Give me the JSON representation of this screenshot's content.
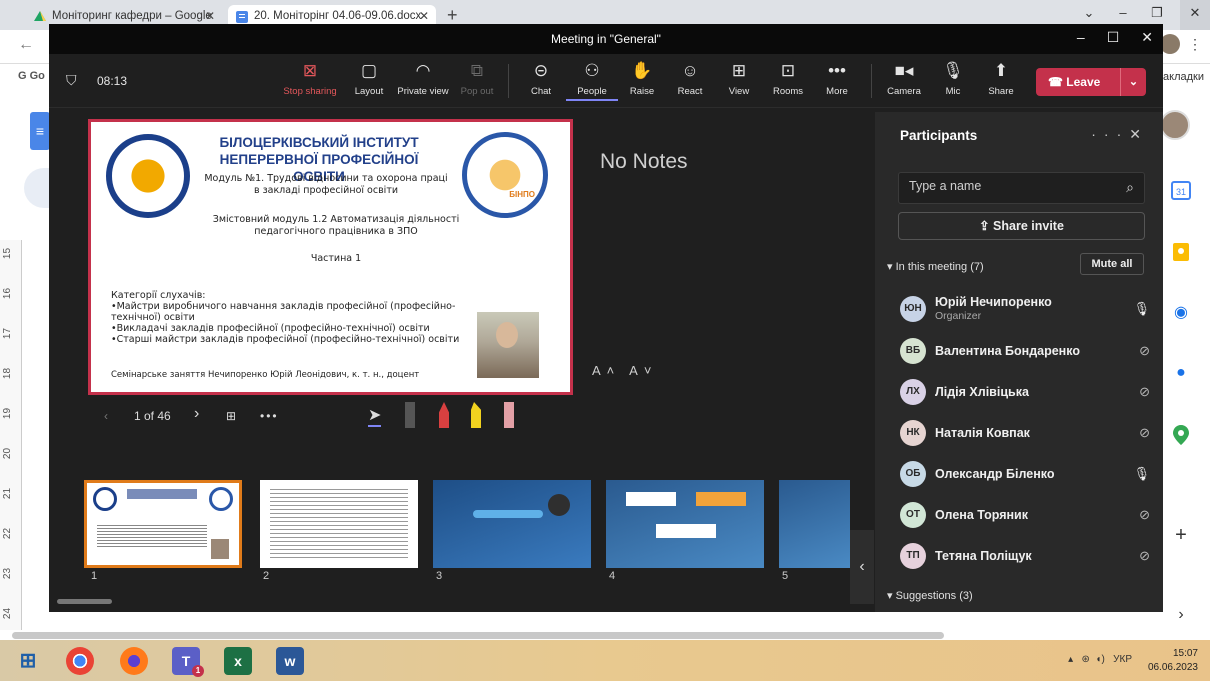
{
  "browser": {
    "tabs": [
      {
        "title": "Моніторинг кафедри – Google",
        "active": false
      },
      {
        "title": "20. Моніторінг 04.06-09.06.docx",
        "active": true
      }
    ],
    "bookmarks_label": "закладки",
    "bookmark_short": "G Go"
  },
  "teams": {
    "window_title": "Meeting in \"General\"",
    "timer": "08:13",
    "toolbar": [
      {
        "label": "Stop sharing",
        "icon": "stop-sharing-icon"
      },
      {
        "label": "Layout",
        "icon": "layout-icon"
      },
      {
        "label": "Private view",
        "icon": "eye-icon"
      },
      {
        "label": "Pop out",
        "icon": "pop-out-icon"
      },
      {
        "label": "Chat",
        "icon": "chat-icon"
      },
      {
        "label": "People",
        "icon": "people-icon"
      },
      {
        "label": "Raise",
        "icon": "raise-hand-icon"
      },
      {
        "label": "React",
        "icon": "react-icon"
      },
      {
        "label": "View",
        "icon": "view-icon"
      },
      {
        "label": "Rooms",
        "icon": "rooms-icon"
      },
      {
        "label": "More",
        "icon": "more-icon"
      },
      {
        "label": "Camera",
        "icon": "camera-icon"
      },
      {
        "label": "Mic",
        "icon": "mic-icon"
      },
      {
        "label": "Share",
        "icon": "share-icon"
      }
    ],
    "leave_label": "Leave",
    "notes_text": "No Notes",
    "font_size_label": "A˄ A˅",
    "slide_counter": "1 of 46",
    "thumbnail_numbers": [
      "1",
      "2",
      "3",
      "4",
      "5"
    ]
  },
  "slide": {
    "institute": "БІЛОЦЕРКІВСЬКИЙ ІНСТИТУТ НЕПЕРЕРВНОЇ ПРОФЕСІЙНОЇ ОСВІТИ",
    "module": "Модуль №1. Трудові відносини та охорона праці в закладі професійної освіти",
    "submodule": "Змістовний модуль 1.2 Автоматизація діяльності педагогічного працівника в ЗПО",
    "part": "Частина 1",
    "listeners_title": "Категорії слухачів:",
    "listeners": [
      "•Майстри виробничого навчання закладів професійної (професійно-технічної) освіти",
      "•Викладачі закладів професійної (професійно-технічної) освіти",
      "•Старші майстри закладів професійної (професійно-технічної) освіти"
    ],
    "seminar": "Семінарське заняття     Нечипоренко Юрій Леонідович, к. т. н., доцент",
    "logo_right_text": "БІНПО"
  },
  "participants": {
    "title": "Participants",
    "search_placeholder": "Type a name",
    "share_invite": "Share invite",
    "in_meeting": "In this meeting (7)",
    "mute_all": "Mute all",
    "suggestions": "Suggestions (3)",
    "people": [
      {
        "initials": "ЮН",
        "name": "Юрій Нечипоренко",
        "role": "Organizer",
        "mic": "on",
        "color": "#c7d3e6"
      },
      {
        "initials": "ВБ",
        "name": "Валентина Бондаренко",
        "role": "",
        "mic": "off",
        "color": "#d6e3d1"
      },
      {
        "initials": "ЛХ",
        "name": "Лідія Хлівіцька",
        "role": "",
        "mic": "off",
        "color": "#d9d1e6"
      },
      {
        "initials": "НК",
        "name": "Наталія Ковпак",
        "role": "",
        "mic": "off",
        "color": "#e6d4d1"
      },
      {
        "initials": "ОБ",
        "name": "Олександр Біленко",
        "role": "",
        "mic": "on",
        "color": "#c7d9e6"
      },
      {
        "initials": "ОТ",
        "name": "Олена Торяник",
        "role": "",
        "mic": "off",
        "color": "#d1e6d6"
      },
      {
        "initials": "ТП",
        "name": "Тетяна Поліщук",
        "role": "",
        "mic": "off",
        "color": "#e6d1dc"
      }
    ]
  },
  "taskbar": {
    "language": "УКР",
    "time": "15:07",
    "date": "06.06.2023",
    "teams_badge": "1"
  },
  "ruler_numbers": [
    "15",
    "16",
    "17",
    "18",
    "19",
    "20",
    "21",
    "22",
    "23",
    "24"
  ]
}
